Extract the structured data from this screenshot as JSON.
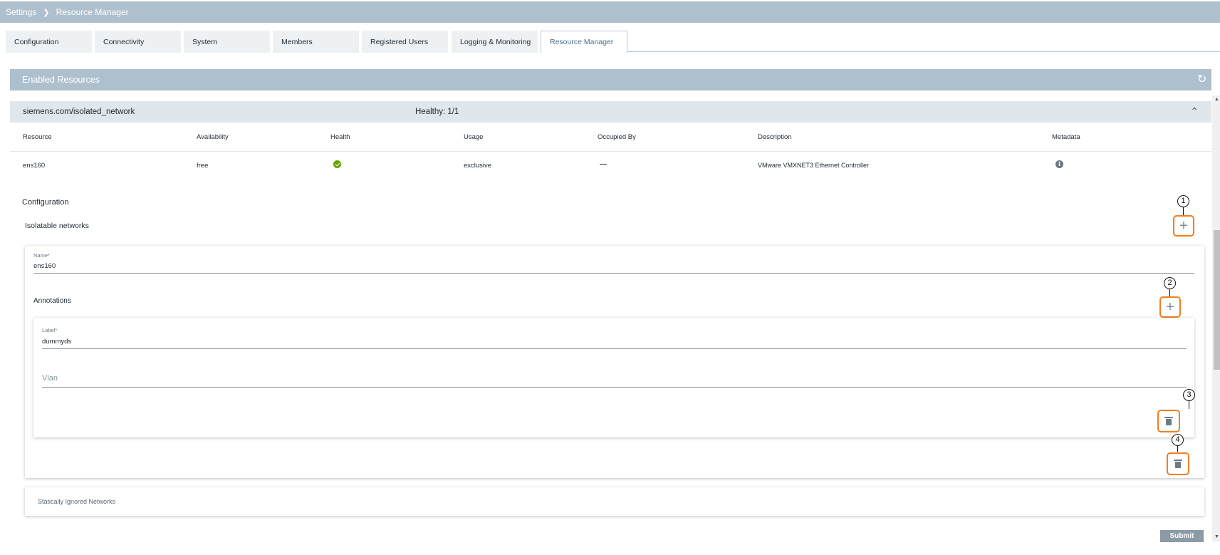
{
  "breadcrumb": {
    "items": [
      "Settings",
      "Resource Manager"
    ]
  },
  "tabs": [
    "Configuration",
    "Connectivity",
    "System",
    "Members",
    "Registered Users",
    "Logging & Monitoring",
    "Resource Manager"
  ],
  "active_tab": "Resource Manager",
  "enabled_resources": {
    "title": "Enabled Resources"
  },
  "group": {
    "name": "siemens.com/isolated_network",
    "health": "Healthy: 1/1"
  },
  "table": {
    "columns": [
      "Resource",
      "Availability",
      "Health",
      "Usage",
      "Occupied By",
      "Description",
      "Metadata"
    ],
    "rows": [
      {
        "resource": "ens160",
        "availability": "free",
        "health": "ok",
        "usage": "exclusive",
        "occupied_by": "—",
        "description": "VMware VMXNET3 Ethernet Controller"
      }
    ]
  },
  "configuration": {
    "title": "Configuration",
    "isolatable_title": "Isolatable networks",
    "name_label": "Name*",
    "name_value": "ens160",
    "annotations_title": "Annotations",
    "label_label": "Label*",
    "label_value": "dummyds",
    "vlan_placeholder": "Vlan",
    "statically_ignored": "Statically Ignored Networks"
  },
  "callouts": [
    "1",
    "2",
    "3",
    "4"
  ],
  "submit_label": "Submit",
  "colors": {
    "accent_header": "#aec0cd",
    "highlight": "#f47e20",
    "health_ok": "#65a30d"
  }
}
